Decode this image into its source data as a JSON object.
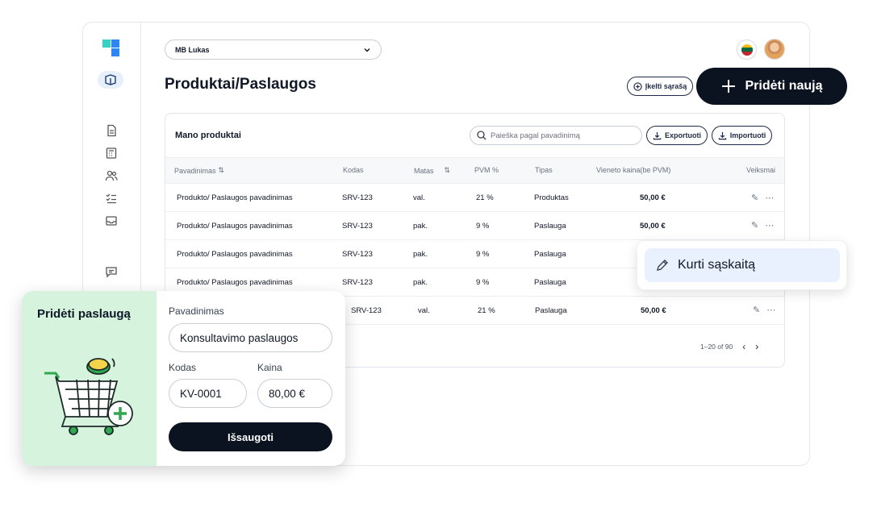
{
  "header": {
    "company": "MB Lukas",
    "page_title": "Produktai/Paslaugos",
    "import_list_label": "Įkelti sąrašą",
    "add_new_label": "Pridėti naują"
  },
  "products": {
    "title": "Mano produktai",
    "search_placeholder": "Paieška pagal pavadinimą",
    "export_label": "Exportuoti",
    "import_label": "Importuoti",
    "columns": [
      "Pavadinimas",
      "Kodas",
      "Matas",
      "PVM %",
      "Tipas",
      "Vieneto kaina(be PVM)",
      "Veiksmai"
    ],
    "rows": [
      [
        "Produkto/ Paslaugos pavadinimas",
        "SRV-123",
        "val.",
        "21 %",
        "Produktas",
        "50,00 €"
      ],
      [
        "Produkto/ Paslaugos pavadinimas",
        "SRV-123",
        "pak.",
        "9 %",
        "Paslauga",
        "50,00 €"
      ],
      [
        "Produkto/ Paslaugos pavadinimas",
        "SRV-123",
        "pak.",
        "9 %",
        "Paslauga",
        ""
      ],
      [
        "Produkto/ Paslaugos pavadinimas",
        "SRV-123",
        "pak.",
        "9 %",
        "Paslauga",
        ""
      ],
      [
        "",
        "SRV-123",
        "val.",
        "21 %",
        "Paslauga",
        "50,00 €"
      ]
    ],
    "pagination": "1–20 of 90"
  },
  "popover": {
    "create_invoice_label": "Kurti sąskaitą"
  },
  "service_form": {
    "title": "Pridėti paslaugą",
    "name_label": "Pavadinimas",
    "name_value": "Konsultavimo paslaugos",
    "code_label": "Kodas",
    "code_value": "KV-0001",
    "price_label": "Kaina",
    "price_value": "80,00 €",
    "save_label": "Išsaugoti"
  },
  "colors": {
    "dark": "#0b1320",
    "accent_green": "#d5f3dd",
    "popover_highlight": "#e8f1fd"
  }
}
